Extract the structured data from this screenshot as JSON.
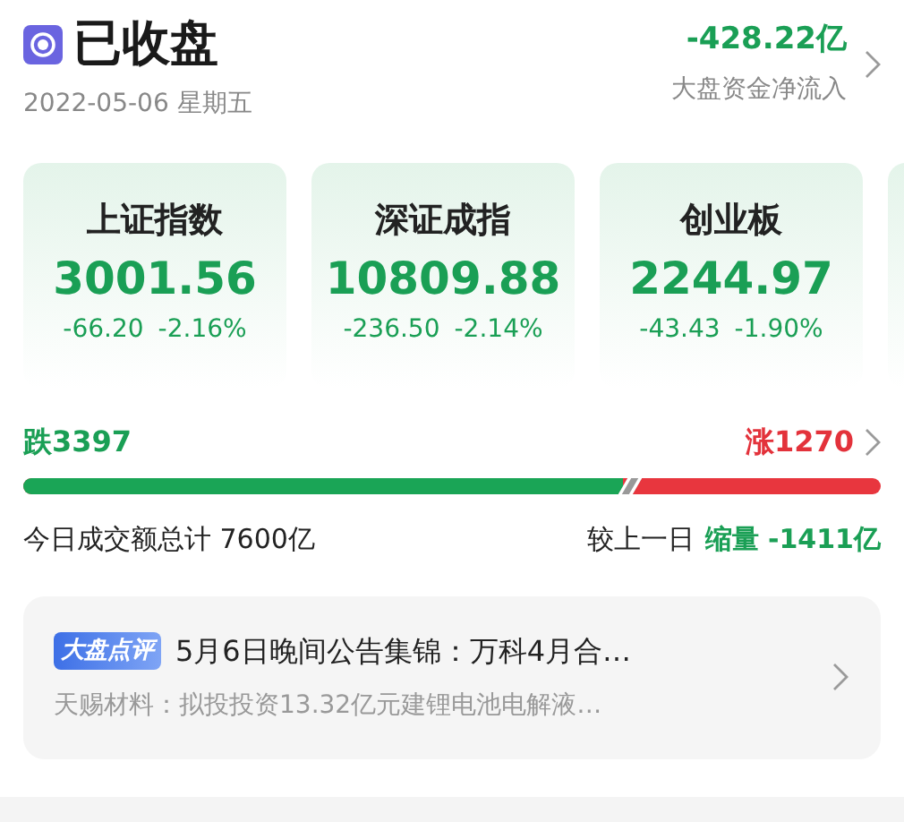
{
  "header": {
    "status": "已收盘",
    "date": "2022-05-06 星期五",
    "net_flow": "-428.22亿",
    "net_flow_label": "大盘资金净流入"
  },
  "indices": [
    {
      "name": "上证指数",
      "value": "3001.56",
      "change": "-66.20",
      "percent": "-2.16%"
    },
    {
      "name": "深证成指",
      "value": "10809.88",
      "change": "-236.50",
      "percent": "-2.14%"
    },
    {
      "name": "创业板",
      "value": "2244.97",
      "change": "-43.43",
      "percent": "-1.90%"
    }
  ],
  "breadth": {
    "falling": "跌3397",
    "rising": "涨1270",
    "level": 0.7
  },
  "turnover": {
    "total": "今日成交额总计 7600亿",
    "compare_label": "较上一日",
    "compare_value": "缩量 -1411亿"
  },
  "news": {
    "tag": "大盘点评",
    "title": "5月6日晚间公告集锦：万科4月合…",
    "summary": "天赐材料：拟投投资13.32亿元建锂电池电解液…"
  }
}
